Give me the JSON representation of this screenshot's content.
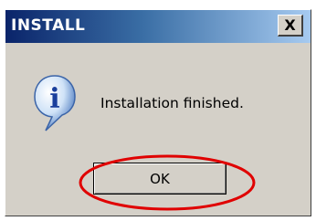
{
  "window": {
    "title": "INSTALL"
  },
  "controls": {
    "close_glyph": "X"
  },
  "dialog": {
    "icon": "info-icon",
    "icon_letter": "i",
    "message": "Installation finished.",
    "ok_label": "OK"
  },
  "annotation": {
    "shape": "oval",
    "color": "#e00000",
    "target": "ok-button"
  }
}
